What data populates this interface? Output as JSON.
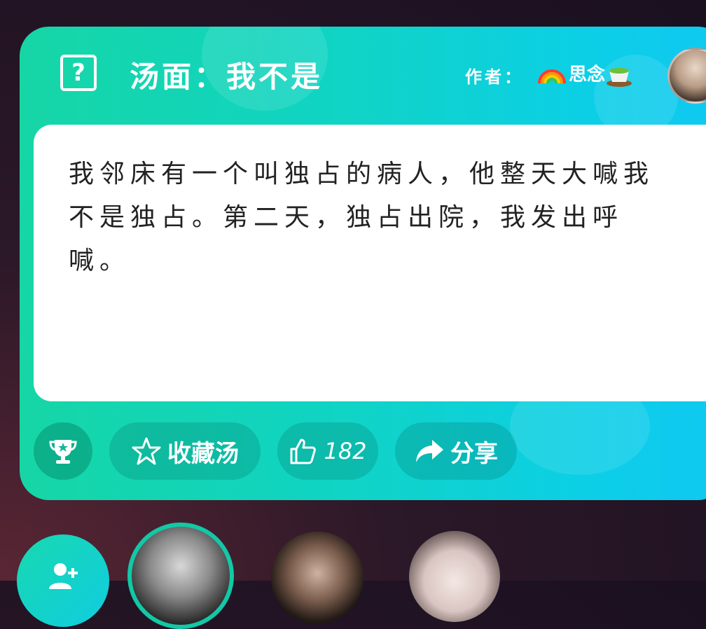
{
  "puzzle": {
    "title": "汤面：我不是",
    "author_label": "作者：",
    "author_name": "思念",
    "content": "我邻床有一个叫独占的病人，他整天大喊我不是独占。第二天，独占出院，我发出呼喊。"
  },
  "actions": {
    "favorite_label": "收藏汤",
    "like_count": "182",
    "share_label": "分享"
  },
  "colors": {
    "card_gradient_start": "#16d6a6",
    "card_gradient_end": "#10c8f2",
    "background": "#2b1828"
  },
  "icons": [
    "question-icon",
    "rainbow-icon",
    "teacup-icon",
    "trophy-icon",
    "star-icon",
    "thumbs-up-icon",
    "share-arrow-icon",
    "add-user-icon"
  ]
}
